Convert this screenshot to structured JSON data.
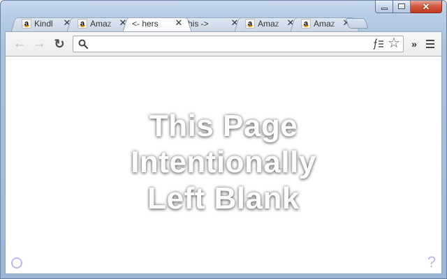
{
  "window": {
    "caption": {
      "close_glyph": "✕"
    }
  },
  "tabs": [
    {
      "title": "Kindl",
      "favicon": "amazon-favicon",
      "active": false
    },
    {
      "title": "Amaz",
      "favicon": "amazon-favicon",
      "active": false
    },
    {
      "title": "<- hers",
      "favicon": null,
      "active": true
    },
    {
      "title": "his ->",
      "favicon": null,
      "active": false
    },
    {
      "title": "Amaz",
      "favicon": "amazon-favicon",
      "active": false
    },
    {
      "title": "Amaz",
      "favicon": "amazon-favicon",
      "active": false
    }
  ],
  "tab_close_glyph": "✕",
  "favicon_letter": "a",
  "toolbar": {
    "back_glyph": "←",
    "forward_glyph": "→",
    "reload_glyph": "↻",
    "omnibox": {
      "value": "",
      "placeholder": ""
    },
    "star_glyph": "☆",
    "overflow_glyph": "»"
  },
  "content": {
    "message_lines": [
      "This Page",
      "Intentionally",
      "Left Blank"
    ],
    "help_glyph": "?"
  },
  "colors": {
    "frame": "#aac1de",
    "corner_icons": "#b9b7f2"
  }
}
